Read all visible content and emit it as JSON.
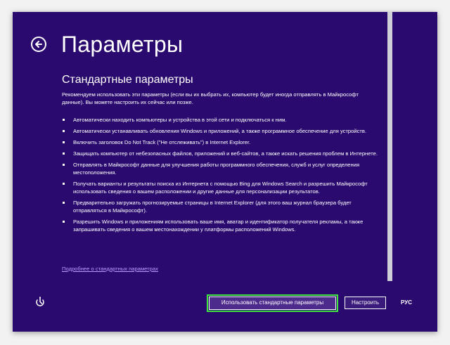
{
  "header": {
    "title": "Параметры",
    "back_icon": "back-arrow-icon"
  },
  "main": {
    "section_title": "Стандартные параметры",
    "intro": "Рекомендуем использовать эти параметры (если вы их выбрать их, компьютер будет иногда отправлять в Майкрософт данные). Вы можете настроить их сейчас или позже.",
    "bullets": [
      "Автоматически находить компьютеры и устройства в этой сети и подключаться к ним.",
      "Автоматически устанавливать обновления Windows и приложений, а также программное обеспечение для устройств.",
      "Включить заголовок Do Not Track (\"Не отслеживать\") в Internet Explorer.",
      "Защищать компьютер от небезопасных файлов, приложений и веб-сайтов, а также искать решения проблем в Интернете.",
      "Отправлять в Майкрософт данные для улучшения работы программного обеспечения, служб и услуг определения местоположения.",
      "Получать варианты и результаты поиска из Интернета с помощью Bing для Windows Search и разрешить Майкрософт использовать сведения о вашем расположении и другие данные для персонализации результатов.",
      "Предварительно загружать прогнозируемые страницы в Internet Explorer (для этого ваш журнал браузера будет отправляться в Майкрософт).",
      "Разрешить Windows и приложениям использовать ваше имя, аватар и идентификатор получателя рекламы, а также запрашивать сведения о вашем местонахождении у платформы расположений Windows."
    ],
    "more_link": "Подробнее о стандартных параметрах"
  },
  "footer": {
    "accessibility_icon": "ease-of-access-icon",
    "primary_button": "Использовать стандартные параметры",
    "customize_button": "Настроить",
    "language": "РУС"
  },
  "colors": {
    "background": "#2a0a6e",
    "text": "#ffffff",
    "link": "#b99cff",
    "highlight": "#3ee63e"
  }
}
